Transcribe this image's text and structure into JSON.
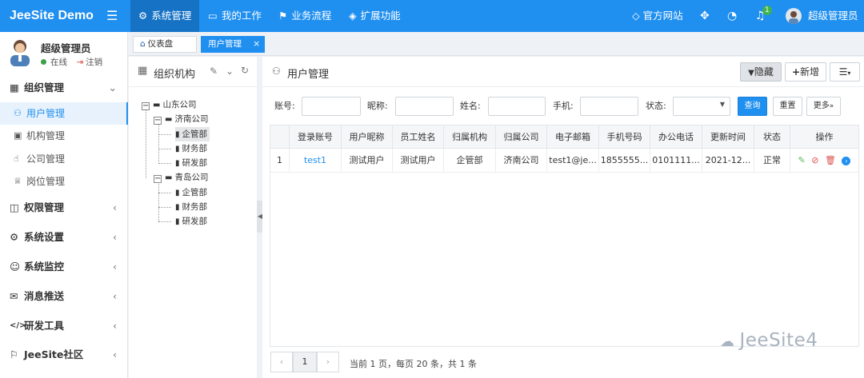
{
  "topbar": {
    "brand": "JeeSite Demo",
    "nav": [
      {
        "label": "系统管理",
        "icon": "gear-icon"
      },
      {
        "label": "我的工作",
        "icon": "monitor-icon"
      },
      {
        "label": "业务流程",
        "icon": "flag-icon"
      },
      {
        "label": "扩展功能",
        "icon": "layers-icon"
      }
    ],
    "official_site": "官方网站",
    "notif_count": "1",
    "admin_name": "超级管理员"
  },
  "sidebar": {
    "user_name": "超级管理员",
    "status": "在线",
    "logout": "注销",
    "groups": [
      {
        "label": "组织管理",
        "icon": "sitemap-icon"
      },
      {
        "label": "权限管理",
        "icon": "cube-icon"
      },
      {
        "label": "系统设置",
        "icon": "gear-icon"
      },
      {
        "label": "系统监控",
        "icon": "monitor-face-icon"
      },
      {
        "label": "消息推送",
        "icon": "envelope-icon"
      },
      {
        "label": "研发工具",
        "icon": "code-icon"
      },
      {
        "label": "JeeSite社区",
        "icon": "signpost-icon"
      }
    ],
    "items": [
      {
        "label": "用户管理",
        "icon": "user-icon"
      },
      {
        "label": "机构管理",
        "icon": "grid-icon"
      },
      {
        "label": "公司管理",
        "icon": "hand-icon"
      },
      {
        "label": "岗位管理",
        "icon": "trophy-icon"
      }
    ]
  },
  "tabs": [
    {
      "label": "仪表盘"
    },
    {
      "label": "用户管理",
      "close": "×"
    }
  ],
  "tree": {
    "title": "组织机构",
    "nodes": [
      {
        "label": "山东公司"
      },
      {
        "label": "济南公司"
      },
      {
        "label": "企管部"
      },
      {
        "label": "财务部"
      },
      {
        "label": "研发部"
      },
      {
        "label": "青岛公司"
      },
      {
        "label": "企管部"
      },
      {
        "label": "财务部"
      },
      {
        "label": "研发部"
      }
    ]
  },
  "content": {
    "title": "用户管理",
    "btn_hide": "隐藏",
    "btn_add": "新增",
    "filters": {
      "account": "账号:",
      "nickname": "昵称:",
      "name": "姓名:",
      "mobile": "手机:",
      "status": "状态:",
      "query": "查询",
      "reset": "重置",
      "more": "更多"
    },
    "columns": [
      "登录账号",
      "用户昵称",
      "员工姓名",
      "归属机构",
      "归属公司",
      "电子邮箱",
      "手机号码",
      "办公电话",
      "更新时间",
      "状态",
      "操作"
    ],
    "rows": [
      {
        "idx": "1",
        "account": "test1",
        "nickname": "测试用户",
        "name": "测试用户",
        "org": "企管部",
        "company": "济南公司",
        "email": "test1@je...",
        "mobile": "1855555...",
        "phone": "0101111...",
        "updated": "2021-12...",
        "status": "正常"
      }
    ],
    "pager": {
      "prev": "‹",
      "page": "1",
      "next": "›",
      "info": "当前 1 页，每页 20 条，共 1 条"
    }
  },
  "watermark": "JeeSite4"
}
